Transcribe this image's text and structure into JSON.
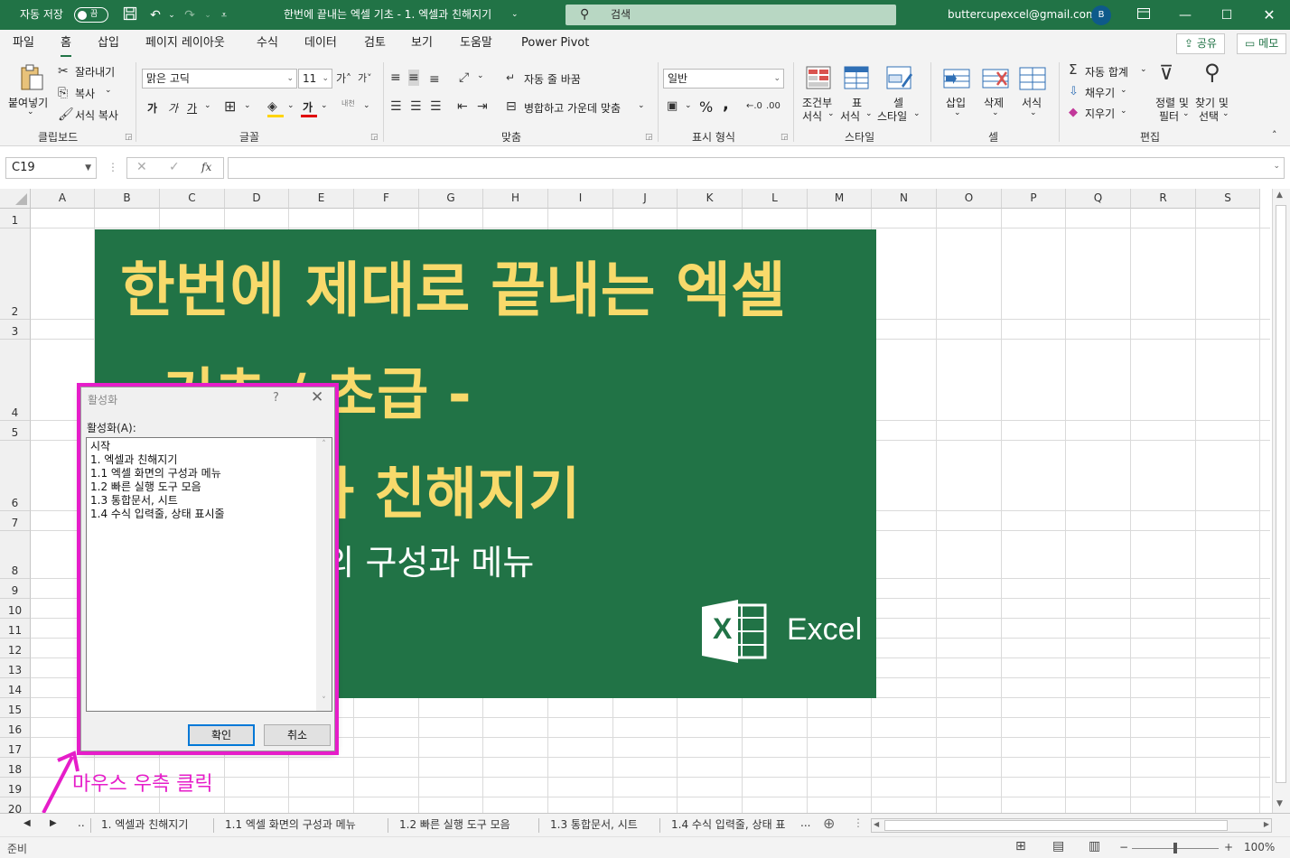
{
  "titlebar": {
    "autosave_label": "자동 저장",
    "autosave_state": "끔",
    "doc_title": "한번에 끝내는 엑셀 기초 - 1. 엑셀과 친해지기",
    "search_placeholder": "검색",
    "account_email": "buttercupexcel@gmail.com",
    "avatar_initial": "B"
  },
  "menu": {
    "tabs": [
      "파일",
      "홈",
      "삽입",
      "페이지 레이아웃",
      "수식",
      "데이터",
      "검토",
      "보기",
      "도움말",
      "Power Pivot"
    ],
    "active_tab": "홈",
    "share_label": "공유",
    "comment_label": "메모"
  },
  "ribbon": {
    "clipboard": {
      "paste": "붙여넣기",
      "cut": "잘라내기",
      "copy": "복사",
      "format_painter": "서식 복사",
      "group": "클립보드"
    },
    "font": {
      "name": "맑은 고딕",
      "size": "11",
      "bold": "가",
      "italic": "가",
      "underline": "가",
      "phonetic": "내천",
      "group": "글꼴",
      "font_color_glyph": "가"
    },
    "alignment": {
      "wrap": "자동 줄 바꿈",
      "merge": "병합하고 가운데 맞춤",
      "group": "맞춤"
    },
    "number": {
      "format": "일반",
      "percent": "%",
      "comma": ",",
      "group": "표시 형식"
    },
    "styles": {
      "conditional_1": "조건부",
      "conditional_2": "서식",
      "table_1": "표",
      "table_2": "서식",
      "cell_1": "셀",
      "cell_2": "스타일",
      "group": "스타일"
    },
    "cells": {
      "insert": "삽입",
      "delete": "삭제",
      "format": "서식",
      "group": "셀"
    },
    "editing": {
      "autosum": "자동 합계",
      "fill": "채우기",
      "clear": "지우기",
      "sort_1": "정렬 및",
      "sort_2": "필터",
      "find_1": "찾기 및",
      "find_2": "선택",
      "group": "편집"
    }
  },
  "formula_bar": {
    "name_box": "C19",
    "fx": "fx",
    "content": ""
  },
  "columns": [
    "A",
    "B",
    "C",
    "D",
    "E",
    "F",
    "G",
    "H",
    "I",
    "J",
    "K",
    "L",
    "M",
    "N",
    "O",
    "P",
    "Q",
    "R",
    "S"
  ],
  "rows": [
    "1",
    "2",
    "3",
    "4",
    "5",
    "6",
    "7",
    "8",
    "9",
    "10",
    "11",
    "12",
    "13",
    "14",
    "15",
    "16",
    "17",
    "18",
    "19",
    "20"
  ],
  "banner": {
    "line1": "한번에 제대로 끝내는 엑셀",
    "line2": "- 기초 / 초급 -",
    "line3": "1. 엑셀과 친해지기",
    "line4": "1.1 엑셀 화면의 구성과 메뉴",
    "logo_text": "Excel",
    "logo_letter": "X",
    "bg_color": "#217346",
    "title_color": "#f8da6b"
  },
  "dialog": {
    "title": "활성화",
    "help": "?",
    "label": "활성화(A):",
    "items": [
      "시작",
      "1. 엑셀과 친해지기",
      "1.1 엑셀 화면의 구성과 메뉴",
      "1.2 빠른 실행 도구 모음",
      "1.3 통합문서, 시트",
      "1.4 수식 입력줄, 상태 표시줄"
    ],
    "ok": "확인",
    "cancel": "취소"
  },
  "annotation": {
    "text": "마우스 우측 클릭",
    "color": "#e61dc9"
  },
  "sheet_tabs": {
    "ellipsis_left": "..",
    "tabs": [
      "1. 엑셀과 친해지기",
      "1.1 엑셀 화면의 구성과 메뉴",
      "1.2 빠른 실행 도구 모음",
      "1.3 통합문서, 시트",
      "1.4 수식 입력줄, 상태 표"
    ],
    "ellipsis_right": "..."
  },
  "status": {
    "ready": "준비",
    "zoom": "100%"
  }
}
